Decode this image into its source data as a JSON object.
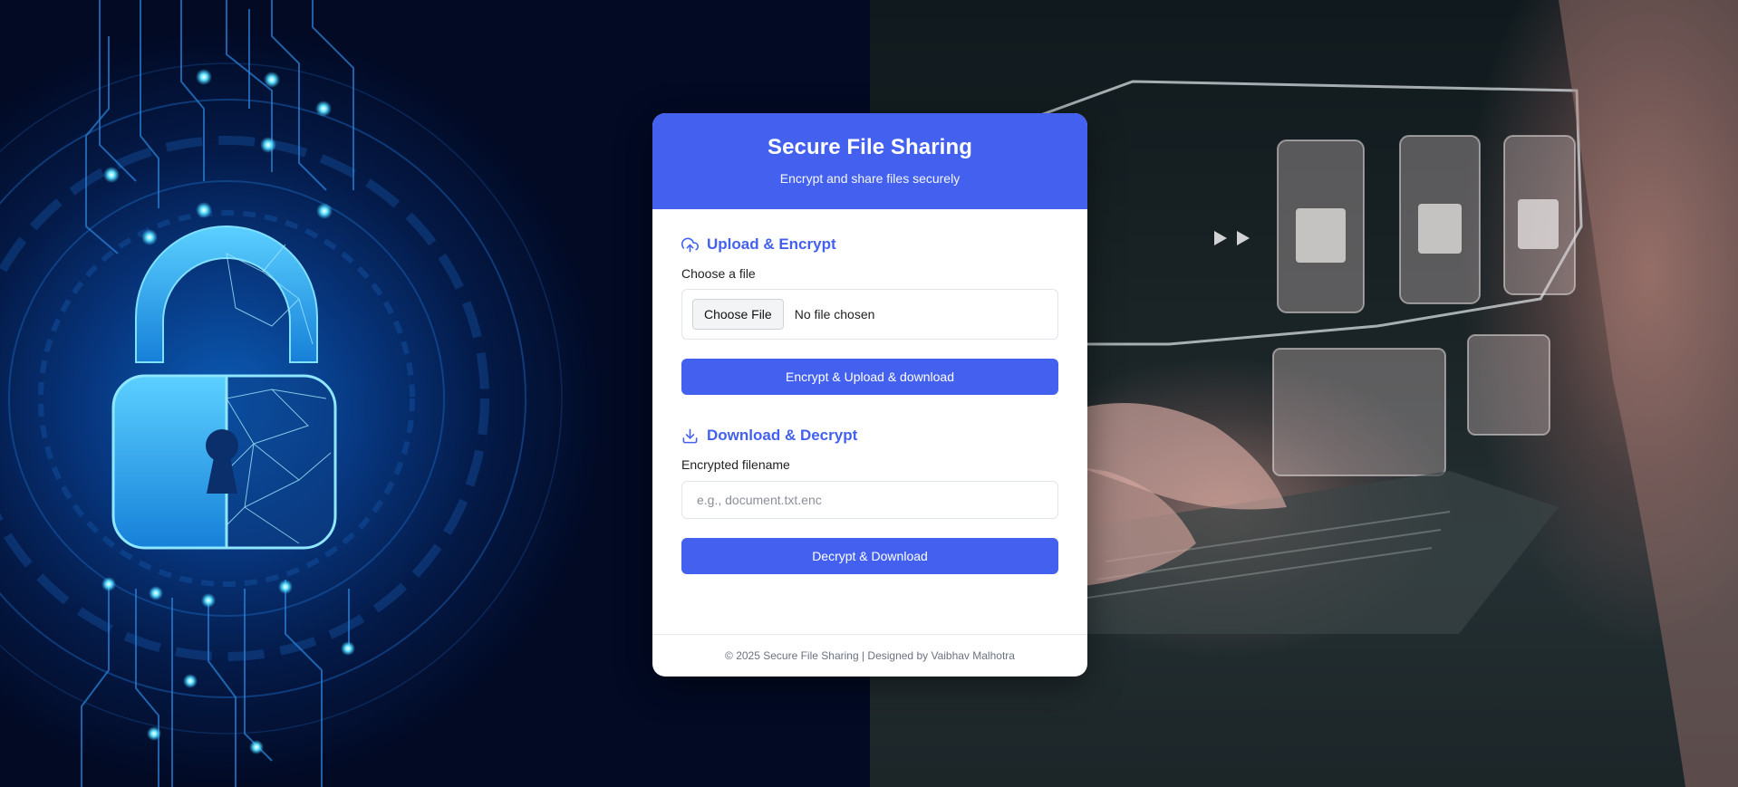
{
  "colors": {
    "accent": "#4361ee",
    "card_background": "#ffffff",
    "footer_text": "#6b7280"
  },
  "header": {
    "title": "Secure File Sharing",
    "subtitle": "Encrypt and share files securely"
  },
  "upload_section": {
    "icon": "cloud-upload-icon",
    "title": "Upload & Encrypt",
    "file_label": "Choose a file",
    "file_button_label": "Choose File",
    "file_status": "No file chosen",
    "submit_label": "Encrypt & Upload & download"
  },
  "download_section": {
    "icon": "download-icon",
    "title": "Download & Decrypt",
    "filename_label": "Encrypted filename",
    "filename_value": "",
    "filename_placeholder": "e.g., document.txt.enc",
    "submit_label": "Decrypt & Download"
  },
  "footer": {
    "text": "© 2025 Secure File Sharing | Designed by Vaibhav Malhotra"
  },
  "background": {
    "left_image": "padlock-circuit-illustration",
    "right_image": "hands-typing-on-laptop-photo"
  }
}
